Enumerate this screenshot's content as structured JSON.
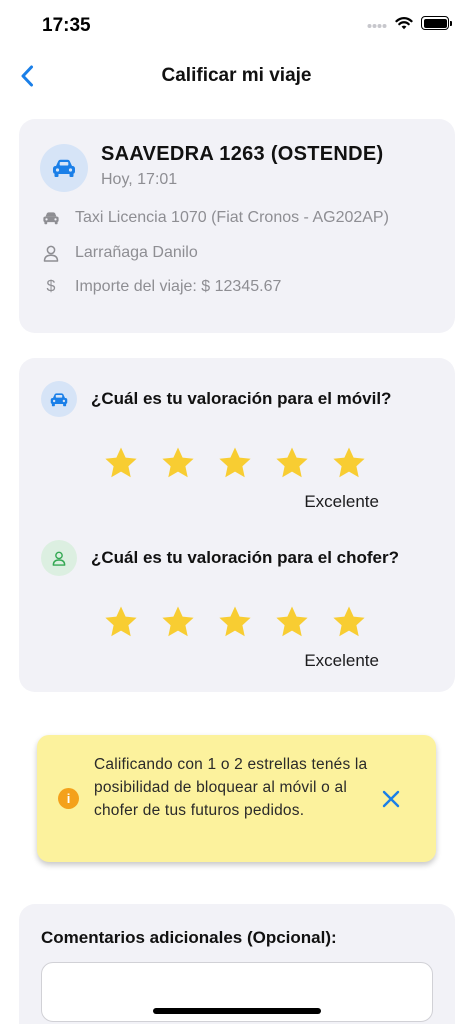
{
  "status": {
    "time": "17:35"
  },
  "nav": {
    "title": "Calificar mi viaje"
  },
  "trip": {
    "title": "SAAVEDRA 1263 (OSTENDE)",
    "date": "Hoy, 17:01",
    "vehicle": "Taxi Licencia 1070 (Fiat Cronos - AG202AP)",
    "driver": "Larrañaga Danilo",
    "amount_symbol": "$",
    "amount": "Importe del viaje: $ 12345.67"
  },
  "ratings": {
    "vehicle": {
      "question": "¿Cuál es tu valoración para el móvil?",
      "stars": 5,
      "label": "Excelente"
    },
    "driver": {
      "question": "¿Cuál es tu valoración para el chofer?",
      "stars": 5,
      "label": "Excelente"
    }
  },
  "banner": {
    "info_symbol": "i",
    "text": "Calificando con 1 o 2 estrellas tenés la posibilidad de bloquear al móvil o al chofer de tus futuros pedidos."
  },
  "comments": {
    "label": "Comentarios adicionales (Opcional):"
  },
  "colors": {
    "accent": "#1a7fe8",
    "star": "#f8cd32",
    "banner": "#fcf29d",
    "info": "#f4a11b"
  },
  "icons": [
    "back-chevron-icon",
    "car-icon",
    "person-icon",
    "dollar-icon",
    "info-icon",
    "close-icon",
    "star-icon",
    "wifi-icon",
    "battery-icon",
    "signal-icon"
  ]
}
